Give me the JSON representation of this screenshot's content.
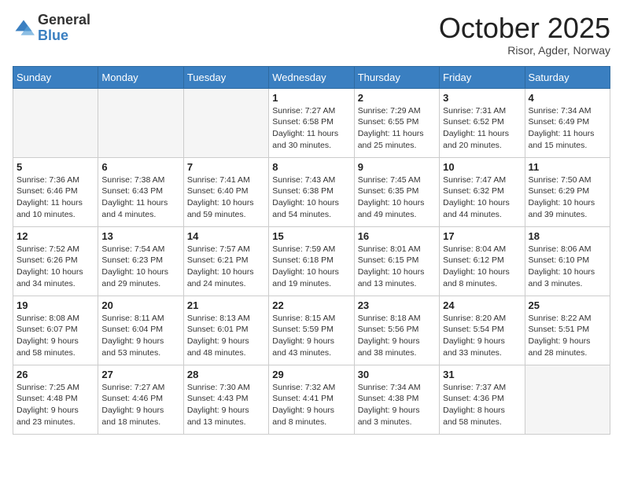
{
  "header": {
    "logo_general": "General",
    "logo_blue": "Blue",
    "month": "October 2025",
    "location": "Risor, Agder, Norway"
  },
  "days_of_week": [
    "Sunday",
    "Monday",
    "Tuesday",
    "Wednesday",
    "Thursday",
    "Friday",
    "Saturday"
  ],
  "weeks": [
    [
      {
        "day": "",
        "info": ""
      },
      {
        "day": "",
        "info": ""
      },
      {
        "day": "",
        "info": ""
      },
      {
        "day": "1",
        "info": "Sunrise: 7:27 AM\nSunset: 6:58 PM\nDaylight: 11 hours\nand 30 minutes."
      },
      {
        "day": "2",
        "info": "Sunrise: 7:29 AM\nSunset: 6:55 PM\nDaylight: 11 hours\nand 25 minutes."
      },
      {
        "day": "3",
        "info": "Sunrise: 7:31 AM\nSunset: 6:52 PM\nDaylight: 11 hours\nand 20 minutes."
      },
      {
        "day": "4",
        "info": "Sunrise: 7:34 AM\nSunset: 6:49 PM\nDaylight: 11 hours\nand 15 minutes."
      }
    ],
    [
      {
        "day": "5",
        "info": "Sunrise: 7:36 AM\nSunset: 6:46 PM\nDaylight: 11 hours\nand 10 minutes."
      },
      {
        "day": "6",
        "info": "Sunrise: 7:38 AM\nSunset: 6:43 PM\nDaylight: 11 hours\nand 4 minutes."
      },
      {
        "day": "7",
        "info": "Sunrise: 7:41 AM\nSunset: 6:40 PM\nDaylight: 10 hours\nand 59 minutes."
      },
      {
        "day": "8",
        "info": "Sunrise: 7:43 AM\nSunset: 6:38 PM\nDaylight: 10 hours\nand 54 minutes."
      },
      {
        "day": "9",
        "info": "Sunrise: 7:45 AM\nSunset: 6:35 PM\nDaylight: 10 hours\nand 49 minutes."
      },
      {
        "day": "10",
        "info": "Sunrise: 7:47 AM\nSunset: 6:32 PM\nDaylight: 10 hours\nand 44 minutes."
      },
      {
        "day": "11",
        "info": "Sunrise: 7:50 AM\nSunset: 6:29 PM\nDaylight: 10 hours\nand 39 minutes."
      }
    ],
    [
      {
        "day": "12",
        "info": "Sunrise: 7:52 AM\nSunset: 6:26 PM\nDaylight: 10 hours\nand 34 minutes."
      },
      {
        "day": "13",
        "info": "Sunrise: 7:54 AM\nSunset: 6:23 PM\nDaylight: 10 hours\nand 29 minutes."
      },
      {
        "day": "14",
        "info": "Sunrise: 7:57 AM\nSunset: 6:21 PM\nDaylight: 10 hours\nand 24 minutes."
      },
      {
        "day": "15",
        "info": "Sunrise: 7:59 AM\nSunset: 6:18 PM\nDaylight: 10 hours\nand 19 minutes."
      },
      {
        "day": "16",
        "info": "Sunrise: 8:01 AM\nSunset: 6:15 PM\nDaylight: 10 hours\nand 13 minutes."
      },
      {
        "day": "17",
        "info": "Sunrise: 8:04 AM\nSunset: 6:12 PM\nDaylight: 10 hours\nand 8 minutes."
      },
      {
        "day": "18",
        "info": "Sunrise: 8:06 AM\nSunset: 6:10 PM\nDaylight: 10 hours\nand 3 minutes."
      }
    ],
    [
      {
        "day": "19",
        "info": "Sunrise: 8:08 AM\nSunset: 6:07 PM\nDaylight: 9 hours\nand 58 minutes."
      },
      {
        "day": "20",
        "info": "Sunrise: 8:11 AM\nSunset: 6:04 PM\nDaylight: 9 hours\nand 53 minutes."
      },
      {
        "day": "21",
        "info": "Sunrise: 8:13 AM\nSunset: 6:01 PM\nDaylight: 9 hours\nand 48 minutes."
      },
      {
        "day": "22",
        "info": "Sunrise: 8:15 AM\nSunset: 5:59 PM\nDaylight: 9 hours\nand 43 minutes."
      },
      {
        "day": "23",
        "info": "Sunrise: 8:18 AM\nSunset: 5:56 PM\nDaylight: 9 hours\nand 38 minutes."
      },
      {
        "day": "24",
        "info": "Sunrise: 8:20 AM\nSunset: 5:54 PM\nDaylight: 9 hours\nand 33 minutes."
      },
      {
        "day": "25",
        "info": "Sunrise: 8:22 AM\nSunset: 5:51 PM\nDaylight: 9 hours\nand 28 minutes."
      }
    ],
    [
      {
        "day": "26",
        "info": "Sunrise: 7:25 AM\nSunset: 4:48 PM\nDaylight: 9 hours\nand 23 minutes."
      },
      {
        "day": "27",
        "info": "Sunrise: 7:27 AM\nSunset: 4:46 PM\nDaylight: 9 hours\nand 18 minutes."
      },
      {
        "day": "28",
        "info": "Sunrise: 7:30 AM\nSunset: 4:43 PM\nDaylight: 9 hours\nand 13 minutes."
      },
      {
        "day": "29",
        "info": "Sunrise: 7:32 AM\nSunset: 4:41 PM\nDaylight: 9 hours\nand 8 minutes."
      },
      {
        "day": "30",
        "info": "Sunrise: 7:34 AM\nSunset: 4:38 PM\nDaylight: 9 hours\nand 3 minutes."
      },
      {
        "day": "31",
        "info": "Sunrise: 7:37 AM\nSunset: 4:36 PM\nDaylight: 8 hours\nand 58 minutes."
      },
      {
        "day": "",
        "info": ""
      }
    ]
  ]
}
